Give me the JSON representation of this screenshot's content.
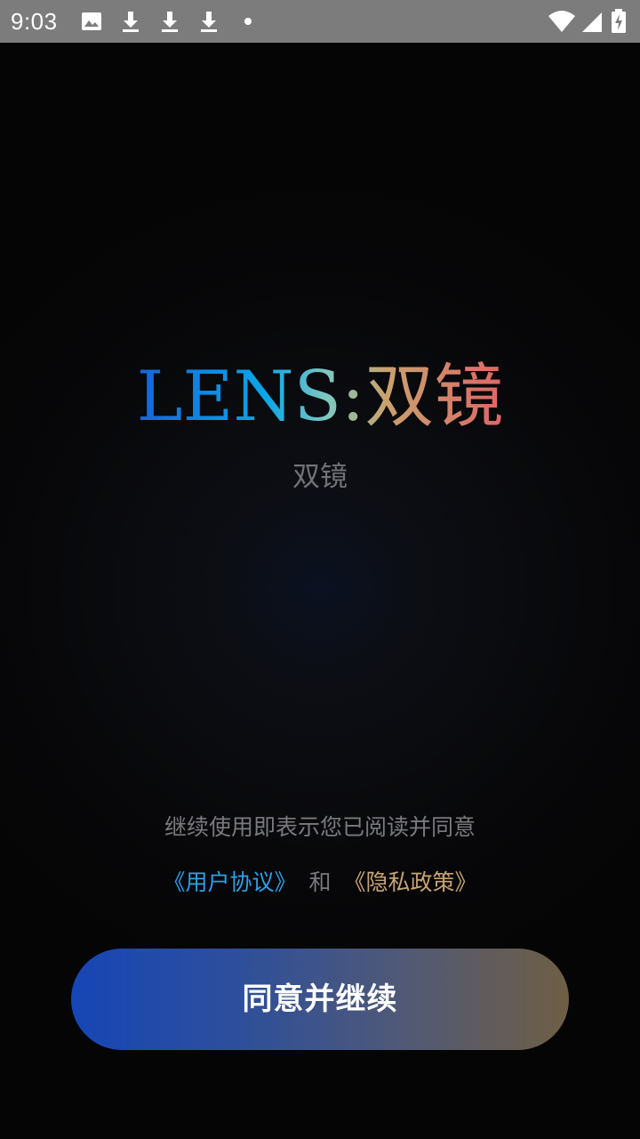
{
  "status_bar": {
    "time": "9:03",
    "icons": [
      "image-icon",
      "download-icon",
      "download-icon",
      "download-icon",
      "dot-icon",
      "wifi-icon",
      "signal-icon",
      "battery-charging-icon"
    ]
  },
  "app": {
    "logo": "LENS:双镜",
    "subtitle": "双镜"
  },
  "agreement": {
    "text": "继续使用即表示您已阅读并同意",
    "user_agreement": "《用户协议》",
    "and": "和",
    "privacy_policy": "《隐私政策》"
  },
  "button": {
    "label": "同意并继续"
  },
  "colors": {
    "status_bar": "#7c7c7c",
    "background": "#050505",
    "link_user": "#2f9fe8",
    "link_privacy": "#c7a374",
    "button_start": "#1646b6",
    "button_end": "#6e5e44"
  }
}
